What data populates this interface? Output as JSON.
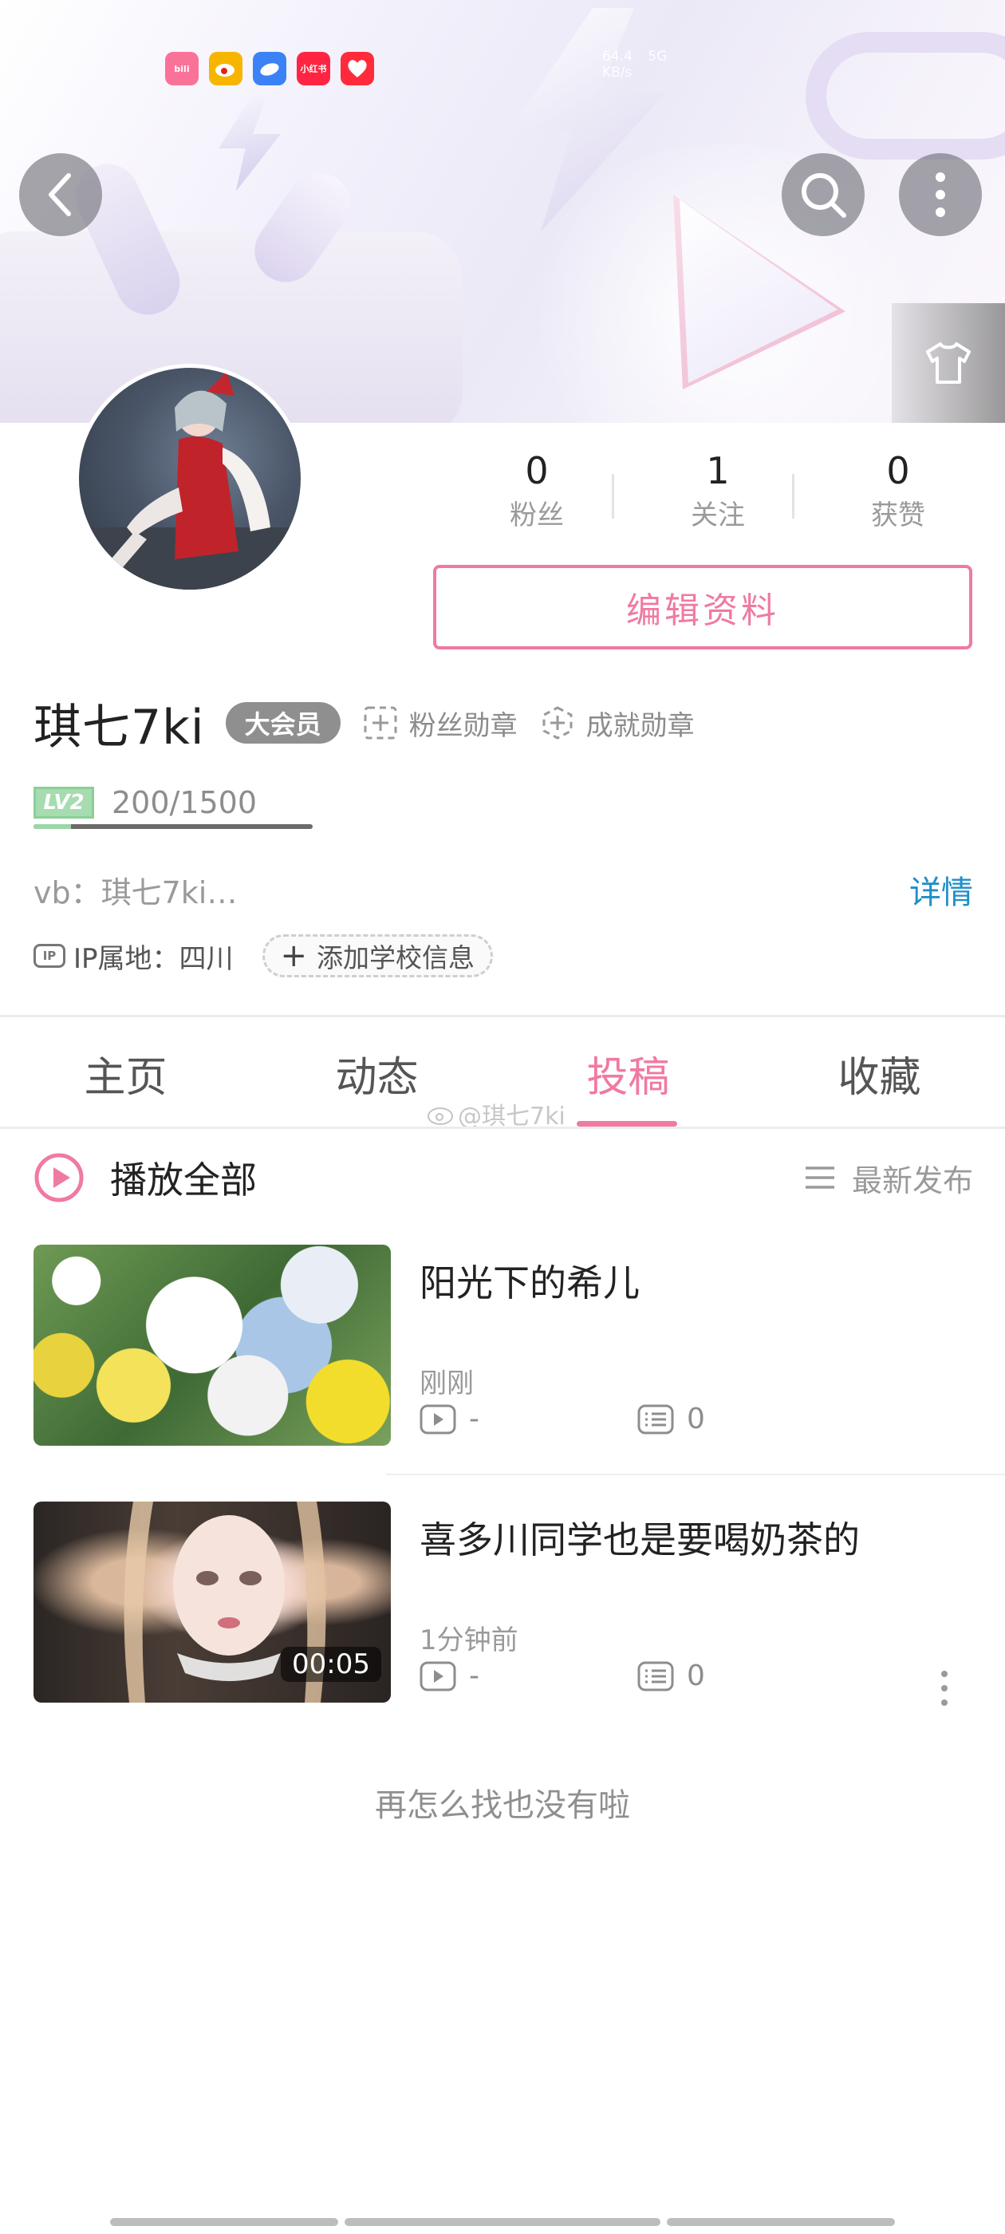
{
  "status_bar": {
    "apps": [
      {
        "icon": "bilibili-app-icon",
        "color": "#fb7299",
        "text": "bili"
      },
      {
        "icon": "weibo-app-icon",
        "color": "#f7b500",
        "text": ""
      },
      {
        "icon": "cloud-app-icon",
        "color": "#3b82f6",
        "text": ""
      },
      {
        "icon": "xiaohongshu-app-icon",
        "color": "#ff2442",
        "text": "小红书"
      },
      {
        "icon": "heart-app-icon",
        "color": "#ff2b3a",
        "text": ""
      }
    ],
    "net_speed": "64.4",
    "net_unit": "KB/s",
    "network": "5G"
  },
  "header": {
    "back_icon": "back-arrow-icon",
    "search_icon": "search-icon",
    "more_icon": "more-vertical-icon",
    "skin_icon": "tshirt-icon"
  },
  "profile": {
    "stats": [
      {
        "value": "0",
        "label": "粉丝"
      },
      {
        "value": "1",
        "label": "关注"
      },
      {
        "value": "0",
        "label": "获赞"
      }
    ],
    "edit_button": "编辑资料",
    "username": "琪七7ki",
    "vip_badge": "大会员",
    "fan_medal": "粉丝勋章",
    "achievement_medal": "成就勋章",
    "level_badge": "LV2",
    "exp_text": "200/1500",
    "exp_progress": 0.133,
    "bio": "vb：琪七7ki…",
    "detail_link": "详情",
    "ip_icon_text": "IP",
    "ip_location": "IP属地：四川",
    "add_school": "添加学校信息",
    "add_school_plus": "+"
  },
  "tabs": [
    {
      "label": "主页",
      "active": false
    },
    {
      "label": "动态",
      "active": false
    },
    {
      "label": "投稿",
      "active": true
    },
    {
      "label": "收藏",
      "active": false
    }
  ],
  "watermark": "@琪七7ki",
  "list_header": {
    "play_all": "播放全部",
    "sort": "最新发布"
  },
  "videos": [
    {
      "title": "阳光下的希儿",
      "time": "刚刚",
      "plays": "-",
      "comments": "0",
      "duration": ""
    },
    {
      "title": "喜多川同学也是要喝奶茶的",
      "time": "1分钟前",
      "plays": "-",
      "comments": "0",
      "duration": "00:05"
    }
  ],
  "end_text": "再怎么找也没有啦",
  "colors": {
    "accent": "#f07aa2",
    "link": "#1f8fc7",
    "level_green": "#9bd7a7"
  }
}
